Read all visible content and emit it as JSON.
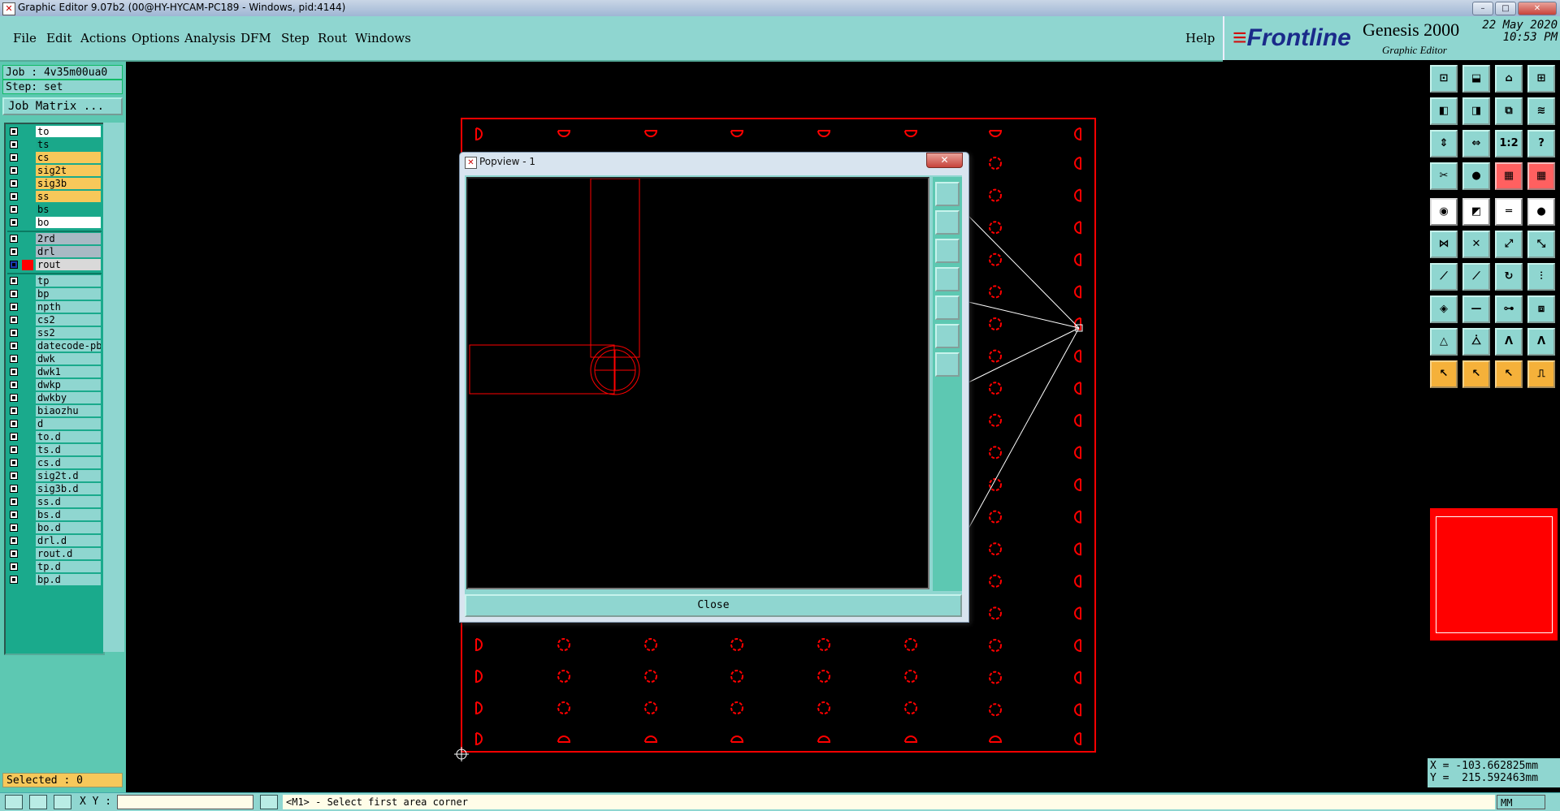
{
  "window": {
    "title": "Graphic Editor 9.07b2 (00@HY-HYCAM-PC189 - Windows, pid:4144)",
    "controls": [
      "–",
      "□",
      "✕"
    ]
  },
  "menu": {
    "items": [
      "File",
      "Edit",
      "Actions",
      "Options",
      "Analysis",
      "DFM",
      "Step",
      "Rout",
      "Windows"
    ],
    "help": "Help"
  },
  "brand": {
    "logo": "Frontline",
    "product": "Genesis 2000",
    "subtitle": "Graphic Editor",
    "date": "22 May 2020",
    "time": "10:53 PM"
  },
  "job": {
    "job_label": "Job : 4v35m00ua0",
    "step_label": "Step: set",
    "matrix_button": "Job Matrix ..."
  },
  "layers": {
    "group1": [
      {
        "name": "to",
        "color": "#ffffff"
      },
      {
        "name": "ts",
        "color": "#1aa88a"
      },
      {
        "name": "cs",
        "color": "#f7c85a"
      },
      {
        "name": "sig2t",
        "color": "#f7c85a"
      },
      {
        "name": "sig3b",
        "color": "#f7c85a"
      },
      {
        "name": "ss",
        "color": "#f7c85a"
      },
      {
        "name": "bs",
        "color": "#1aa88a"
      },
      {
        "name": "bo",
        "color": "#ffffff"
      }
    ],
    "group2": [
      {
        "name": "2rd",
        "color": "#a9b9c4"
      },
      {
        "name": "drl",
        "color": "#a9b9c4"
      },
      {
        "name": "rout",
        "color": "#d9d9d9"
      }
    ],
    "group3": [
      {
        "name": "tp"
      },
      {
        "name": "bp"
      },
      {
        "name": "npth"
      },
      {
        "name": "cs2"
      },
      {
        "name": "ss2"
      },
      {
        "name": "datecode-pbo"
      },
      {
        "name": "dwk"
      },
      {
        "name": "dwk1"
      },
      {
        "name": "dwkp"
      },
      {
        "name": "dwkby"
      },
      {
        "name": "biaozhu"
      },
      {
        "name": "d"
      },
      {
        "name": "to.d"
      },
      {
        "name": "ts.d"
      },
      {
        "name": "cs.d"
      },
      {
        "name": "sig2t.d"
      },
      {
        "name": "sig3b.d"
      },
      {
        "name": "ss.d"
      },
      {
        "name": "bs.d"
      },
      {
        "name": "bo.d"
      },
      {
        "name": "drl.d"
      },
      {
        "name": "rout.d"
      },
      {
        "name": "tp.d"
      },
      {
        "name": "bp.d"
      }
    ]
  },
  "selected": "Selected : 0",
  "popview": {
    "title": "Popview - 1",
    "close_button": "Close"
  },
  "coords": {
    "x": "X = -103.662825mm",
    "y": "Y =  215.592463mm"
  },
  "status": {
    "xy_label": "X Y :",
    "xy_value": "",
    "message": "<M1> - Select first area corner",
    "units": "MM"
  },
  "colors": {
    "panel": "#8fd6d0",
    "panel_dark": "#5dc8b2",
    "highlight_orange": "#f7c85a",
    "layer_red": "#ff0000"
  },
  "right_toolbar_icons": [
    "zoom-home-icon",
    "zoom-in-icon",
    "home-icon",
    "window-split-icon",
    "pan-left-icon",
    "pan-right-icon",
    "zoom-window-icon",
    "pan-icon",
    "fit-screen-icon",
    "fit-profile-icon",
    "scale-1-2-icon",
    "help-query-icon",
    "snap-icon",
    "measure-icon",
    "layer-compare-icon",
    "layer-toggle-icon",
    "add-pad-icon",
    "add-line-icon",
    "ruler-icon",
    "add-dot-icon",
    "connect-icon",
    "delete-node-icon",
    "move-node-icon",
    "break-line-icon",
    "draw-line-icon",
    "draw-line-red-icon",
    "arc-icon",
    "split-icon",
    "add-feature-icon",
    "dash-icon",
    "resize-icon",
    "copy-icon",
    "triangle-icon",
    "triangle-fill-icon",
    "route-a-icon",
    "route-b-icon",
    "select-icon",
    "select-orange-icon",
    "select-rotate-icon",
    "stair-icon"
  ]
}
